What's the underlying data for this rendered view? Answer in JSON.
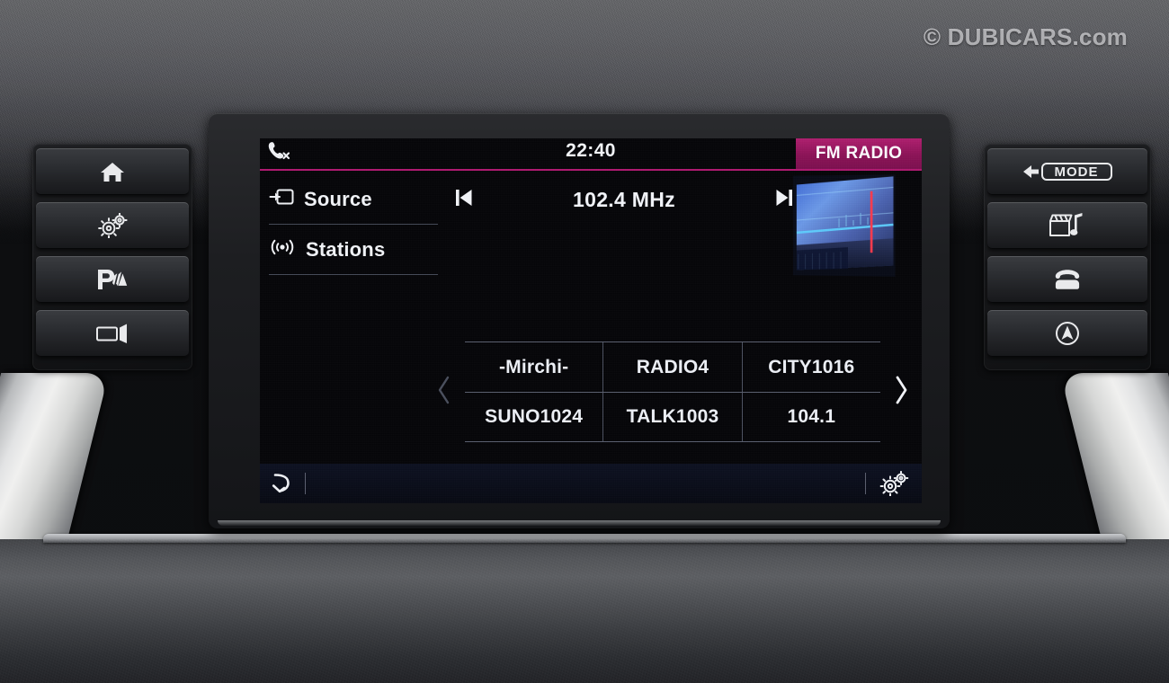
{
  "watermark": {
    "text": "© DUBICARS.com"
  },
  "screen": {
    "status_bar": {
      "phone_icon": "phone-mute-icon",
      "clock": "22:40",
      "band_badge": "FM RADIO",
      "accent_color": "#b11a72"
    },
    "nav_items": [
      {
        "label": "Source",
        "icon": "source-input-icon"
      },
      {
        "label": "Stations",
        "icon": "broadcast-signal-icon"
      }
    ],
    "tuner": {
      "prev_icon": "skip-previous-icon",
      "frequency": "102.4 MHz",
      "next_icon": "skip-next-icon"
    },
    "album_art": {
      "name": "radio-visualizer-thumbnail"
    },
    "presets": {
      "prev_page_icon": "chevron-left-icon",
      "next_page_icon": "chevron-right-icon",
      "rows": [
        [
          "-Mirchi-",
          "RADIO4",
          "CITY1016"
        ],
        [
          "SUNO1024",
          "TALK1003",
          "104.1"
        ]
      ]
    },
    "bottom_bar": {
      "back_icon": "back-arrow-icon",
      "settings_icon": "gears-settings-icon"
    }
  },
  "hardware": {
    "left_buttons": [
      {
        "name": "home-button",
        "icon": "home-icon"
      },
      {
        "name": "settings-button",
        "icon": "gears-icon"
      },
      {
        "name": "park-assist-button",
        "icon": "park-assist-icon"
      },
      {
        "name": "camera-button",
        "icon": "camera-icon"
      }
    ],
    "right_buttons": [
      {
        "name": "mode-button",
        "icon": "mode-icon",
        "label": "MODE"
      },
      {
        "name": "media-button",
        "icon": "media-icon"
      },
      {
        "name": "phone-button",
        "icon": "telephone-icon"
      },
      {
        "name": "navigation-button",
        "icon": "navigation-icon"
      }
    ]
  }
}
